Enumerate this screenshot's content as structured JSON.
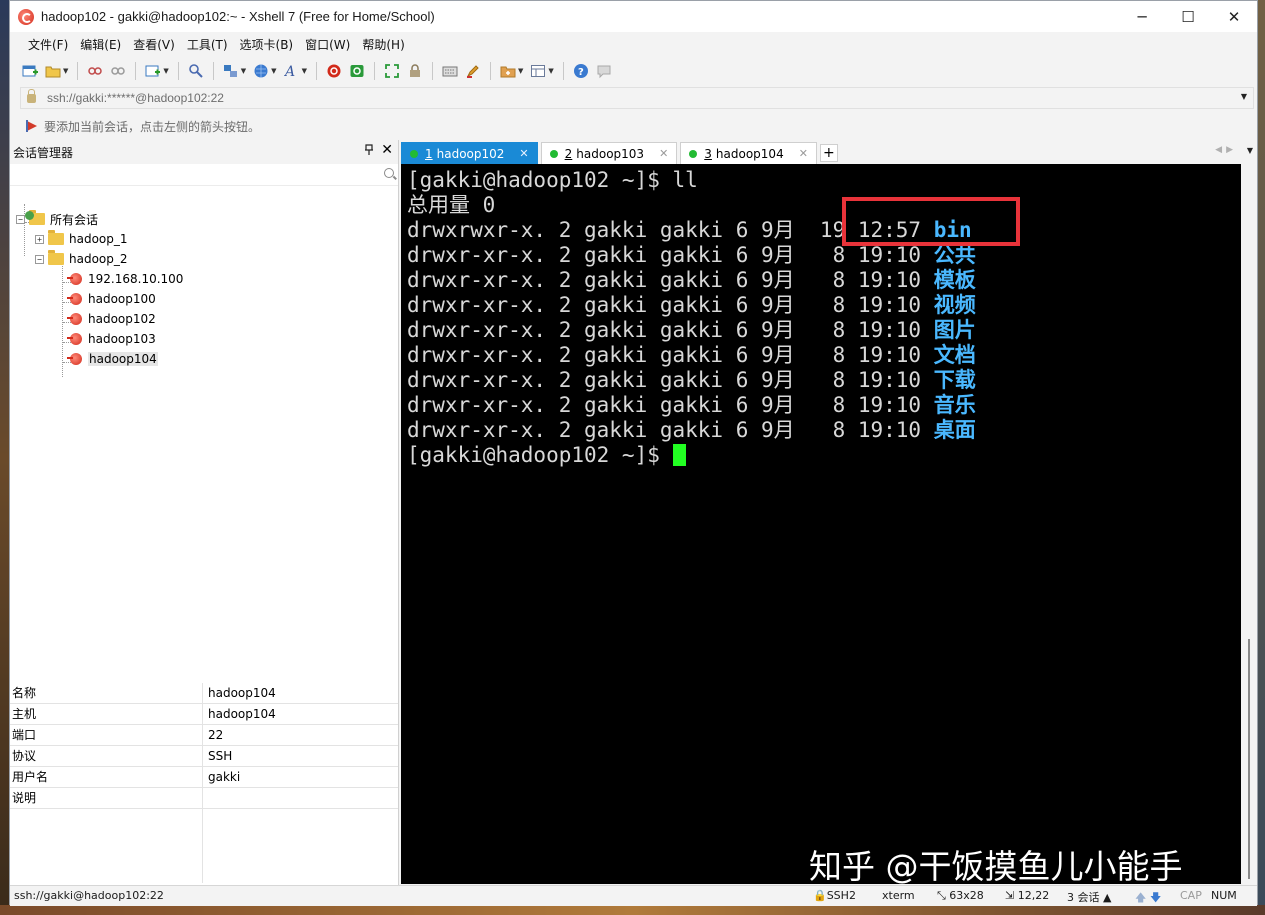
{
  "window": {
    "title": "hadoop102 - gakki@hadoop102:~ - Xshell 7 (Free for Home/School)",
    "minimize": "─",
    "maximize": "☐",
    "close": "✕"
  },
  "menu": [
    "文件(F)",
    "编辑(E)",
    "查看(V)",
    "工具(T)",
    "选项卡(B)",
    "窗口(W)",
    "帮助(H)"
  ],
  "address": "ssh://gakki:******@hadoop102:22",
  "hint": "要添加当前会话，点击左侧的箭头按钮。",
  "session_manager": {
    "title": "会话管理器",
    "pin": "ᵖ",
    "close": "✕",
    "tree": {
      "root": "所有会话",
      "folder1": "hadoop_1",
      "folder2": "hadoop_2",
      "sessions": [
        "192.168.10.100",
        "hadoop100",
        "hadoop102",
        "hadoop103",
        "hadoop104"
      ]
    },
    "properties": [
      {
        "key": "名称",
        "value": "hadoop104"
      },
      {
        "key": "主机",
        "value": "hadoop104"
      },
      {
        "key": "端口",
        "value": "22"
      },
      {
        "key": "协议",
        "value": "SSH"
      },
      {
        "key": "用户名",
        "value": "gakki"
      },
      {
        "key": "说明",
        "value": ""
      }
    ]
  },
  "tabs": [
    {
      "num": "1",
      "label": "hadoop102",
      "active": true
    },
    {
      "num": "2",
      "label": "hadoop103",
      "active": false
    },
    {
      "num": "3",
      "label": "hadoop104",
      "active": false
    }
  ],
  "terminal": {
    "prompt": "[gakki@hadoop102 ~]$ ",
    "command": "ll",
    "total": "总用量 0",
    "rows": [
      {
        "meta": "drwxrwxr-x. 2 gakki gakki 6 9月  19 12:57 ",
        "name": "bin"
      },
      {
        "meta": "drwxr-xr-x. 2 gakki gakki 6 9月   8 19:10 ",
        "name": "公共"
      },
      {
        "meta": "drwxr-xr-x. 2 gakki gakki 6 9月   8 19:10 ",
        "name": "模板"
      },
      {
        "meta": "drwxr-xr-x. 2 gakki gakki 6 9月   8 19:10 ",
        "name": "视频"
      },
      {
        "meta": "drwxr-xr-x. 2 gakki gakki 6 9月   8 19:10 ",
        "name": "图片"
      },
      {
        "meta": "drwxr-xr-x. 2 gakki gakki 6 9月   8 19:10 ",
        "name": "文档"
      },
      {
        "meta": "drwxr-xr-x. 2 gakki gakki 6 9月   8 19:10 ",
        "name": "下载"
      },
      {
        "meta": "drwxr-xr-x. 2 gakki gakki 6 9月   8 19:10 ",
        "name": "音乐"
      },
      {
        "meta": "drwxr-xr-x. 2 gakki gakki 6 9月   8 19:10 ",
        "name": "桌面"
      }
    ],
    "watermark": "知乎 @干饭摸鱼儿小能手"
  },
  "statusbar": {
    "connection": "ssh://gakki@hadoop102:22",
    "protocol": "SSH2",
    "terminal_type": "xterm",
    "size": "63x28",
    "position": "12,22",
    "sessions": "3 会话",
    "cap": "CAP",
    "num": "NUM"
  },
  "colors": {
    "active_tab": "#1a8ad6",
    "directory": "#4ab8ff",
    "cursor": "#22ff22",
    "highlight": "#e8333a",
    "status_dot": "#22bb33"
  }
}
